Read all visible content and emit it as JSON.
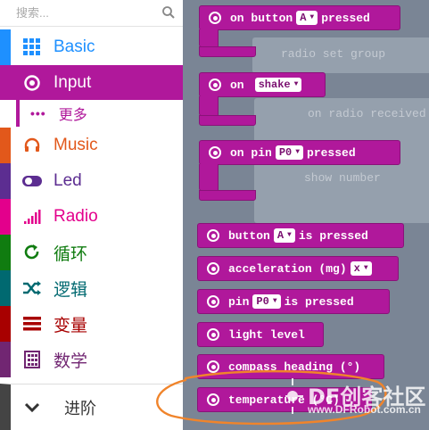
{
  "search": {
    "placeholder": "搜索..."
  },
  "colors": {
    "basic": "#1e90ff",
    "input": "#b0189b",
    "music": "#e2581b",
    "led": "#5c2d91",
    "radio": "#e3008c",
    "loops": "#107c10",
    "logic": "#006970",
    "variables": "#a80000",
    "math": "#712672",
    "advanced": "#444444",
    "workspace": "#7a8595",
    "annotation": "#f0842b"
  },
  "categories": [
    {
      "key": "basic",
      "label": "Basic",
      "icon": "grid-icon"
    },
    {
      "key": "input",
      "label": "Input",
      "icon": "radio-icon"
    },
    {
      "key": "music",
      "label": "Music",
      "icon": "headphones-icon"
    },
    {
      "key": "led",
      "label": "Led",
      "icon": "toggle-icon"
    },
    {
      "key": "radio",
      "label": "Radio",
      "icon": "signal-bars-icon"
    },
    {
      "key": "loops",
      "label": "循环",
      "icon": "refresh-icon"
    },
    {
      "key": "logic",
      "label": "逻辑",
      "icon": "shuffle-icon"
    },
    {
      "key": "variables",
      "label": "变量",
      "icon": "lines-icon"
    },
    {
      "key": "math",
      "label": "数学",
      "icon": "calculator-icon"
    }
  ],
  "sub": {
    "dots": "•••",
    "label": "更多"
  },
  "advanced": {
    "label": "进阶",
    "icon": "chevron-down-icon"
  },
  "blocks": {
    "on_button": {
      "pre": "on button",
      "field": "A",
      "post": "pressed"
    },
    "on_shake": {
      "pre": "on",
      "field": "shake"
    },
    "on_pin": {
      "pre": "on pin",
      "field": "P0",
      "post": "pressed"
    },
    "button_is": {
      "pre": "button",
      "field": "A",
      "post": "is pressed"
    },
    "acceleration": {
      "pre": "acceleration (mg)",
      "field": "x"
    },
    "pin_is": {
      "pre": "pin",
      "field": "P0",
      "post": "is pressed"
    },
    "light": {
      "pre": "light level"
    },
    "compass": {
      "pre": "compass heading (°)"
    },
    "temperature": {
      "pre": "temperature (°C)"
    }
  },
  "ghosts": {
    "radio_group": "radio set group",
    "received": "on radio received",
    "show_number": "show number"
  },
  "watermark": {
    "text": "DF创客社区",
    "sub": "www.DFRobot.com.cn"
  }
}
